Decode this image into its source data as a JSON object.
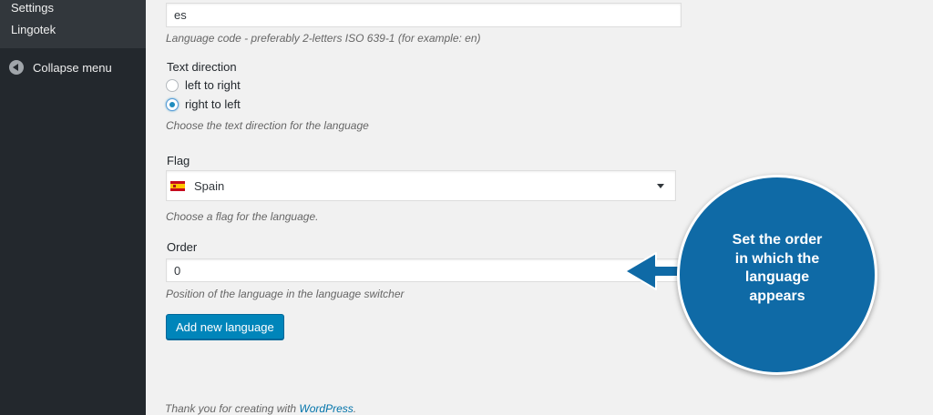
{
  "sidebar": {
    "submenu": [
      {
        "label": "Settings"
      },
      {
        "label": "Lingotek"
      }
    ],
    "collapse_label": "Collapse menu"
  },
  "form": {
    "language_code": {
      "value": "es",
      "description": "Language code - preferably 2-letters ISO 639-1 (for example: en)"
    },
    "text_direction": {
      "label": "Text direction",
      "options": [
        {
          "label": "left to right",
          "checked": false
        },
        {
          "label": "right to left",
          "checked": true
        }
      ],
      "description": "Choose the text direction for the language"
    },
    "flag": {
      "label": "Flag",
      "selected": "Spain",
      "description": "Choose a flag for the language."
    },
    "order": {
      "label": "Order",
      "value": "0",
      "description": "Position of the language in the language switcher"
    },
    "submit_label": "Add new language"
  },
  "footer": {
    "text": "Thank you for creating with ",
    "link": "WordPress",
    "end": "."
  },
  "callout": {
    "lines": [
      "Set the order",
      "in which the",
      "language",
      "appears"
    ]
  },
  "colors": {
    "sidebar_bg": "#23282d",
    "primary_button": "#0085ba",
    "callout_bg": "#0f6aa6"
  }
}
